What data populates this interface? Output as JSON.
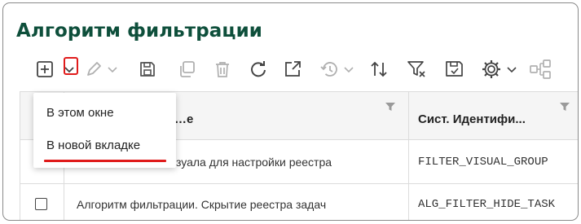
{
  "title": "Алгоритм фильтрации",
  "toolbar": {
    "icons": [
      "add-icon",
      "dropdown-chevron-icon",
      "edit-icon",
      "chevron-down-icon",
      "save-icon",
      "copy-icon",
      "delete-icon",
      "refresh-icon",
      "open-external-icon",
      "history-icon",
      "chevron-down-icon",
      "sort-icon",
      "clear-filter-icon",
      "save-filter-icon",
      "settings-icon",
      "chevron-down-icon",
      "share-icon"
    ],
    "accent": "#e01b1b",
    "icon_color": "#555555",
    "disabled_color": "#b0b0b0"
  },
  "menu": {
    "items": [
      "В этом окне",
      "В новой вкладке"
    ]
  },
  "table": {
    "columns": [
      "…е",
      "Сист. Идентифи..."
    ],
    "rows": [
      {
        "name": "…зуала для настройки реестра",
        "id": "FILTER_VISUAL_GROUP"
      },
      {
        "name": "Алгоритм фильтрации. Скрытие реестра задач",
        "id": "ALG_FILTER_HIDE_TASK"
      }
    ]
  },
  "colors": {
    "title": "#0e4f3b",
    "header_bg": "#f5f5f5",
    "border": "#dcdcdc"
  }
}
